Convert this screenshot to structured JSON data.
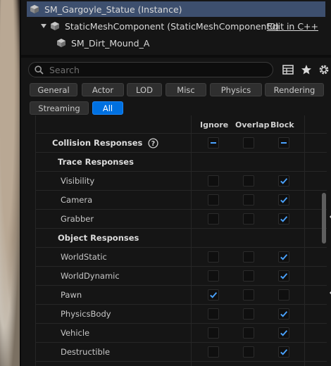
{
  "tree": {
    "actor_label": "SM_Gargoyle_Statue (Instance)",
    "component_label": "StaticMeshComponent (StaticMeshComponent0)",
    "edit_link": "Edit in C++",
    "child_label": "SM_Dirt_Mound_A"
  },
  "search": {
    "placeholder": "Search"
  },
  "tabs": [
    "General",
    "Actor",
    "LOD",
    "Misc",
    "Physics",
    "Rendering",
    "Streaming",
    "All"
  ],
  "active_tab": "All",
  "columns": {
    "ignore": "Ignore",
    "overlap": "Overlap",
    "block": "Block"
  },
  "collision_responses_label": "Collision Responses",
  "trace_responses_label": "Trace Responses",
  "object_responses_label": "Object Responses",
  "rows": [
    {
      "label": "Visibility",
      "ignore": false,
      "overlap": false,
      "block": true
    },
    {
      "label": "Camera",
      "ignore": false,
      "overlap": false,
      "block": true
    },
    {
      "label": "Grabber",
      "ignore": false,
      "overlap": false,
      "block": true,
      "modified": true
    },
    {
      "label": "WorldStatic",
      "ignore": false,
      "overlap": false,
      "block": true
    },
    {
      "label": "WorldDynamic",
      "ignore": false,
      "overlap": false,
      "block": true
    },
    {
      "label": "Pawn",
      "ignore": true,
      "overlap": false,
      "block": false,
      "modified": true
    },
    {
      "label": "PhysicsBody",
      "ignore": false,
      "overlap": false,
      "block": true
    },
    {
      "label": "Vehicle",
      "ignore": false,
      "overlap": false,
      "block": true
    },
    {
      "label": "Destructible",
      "ignore": false,
      "overlap": false,
      "block": true
    }
  ],
  "colors": {
    "accent": "#0070e0",
    "check": "#4aa3ff",
    "selection": "#3d4f6e"
  }
}
